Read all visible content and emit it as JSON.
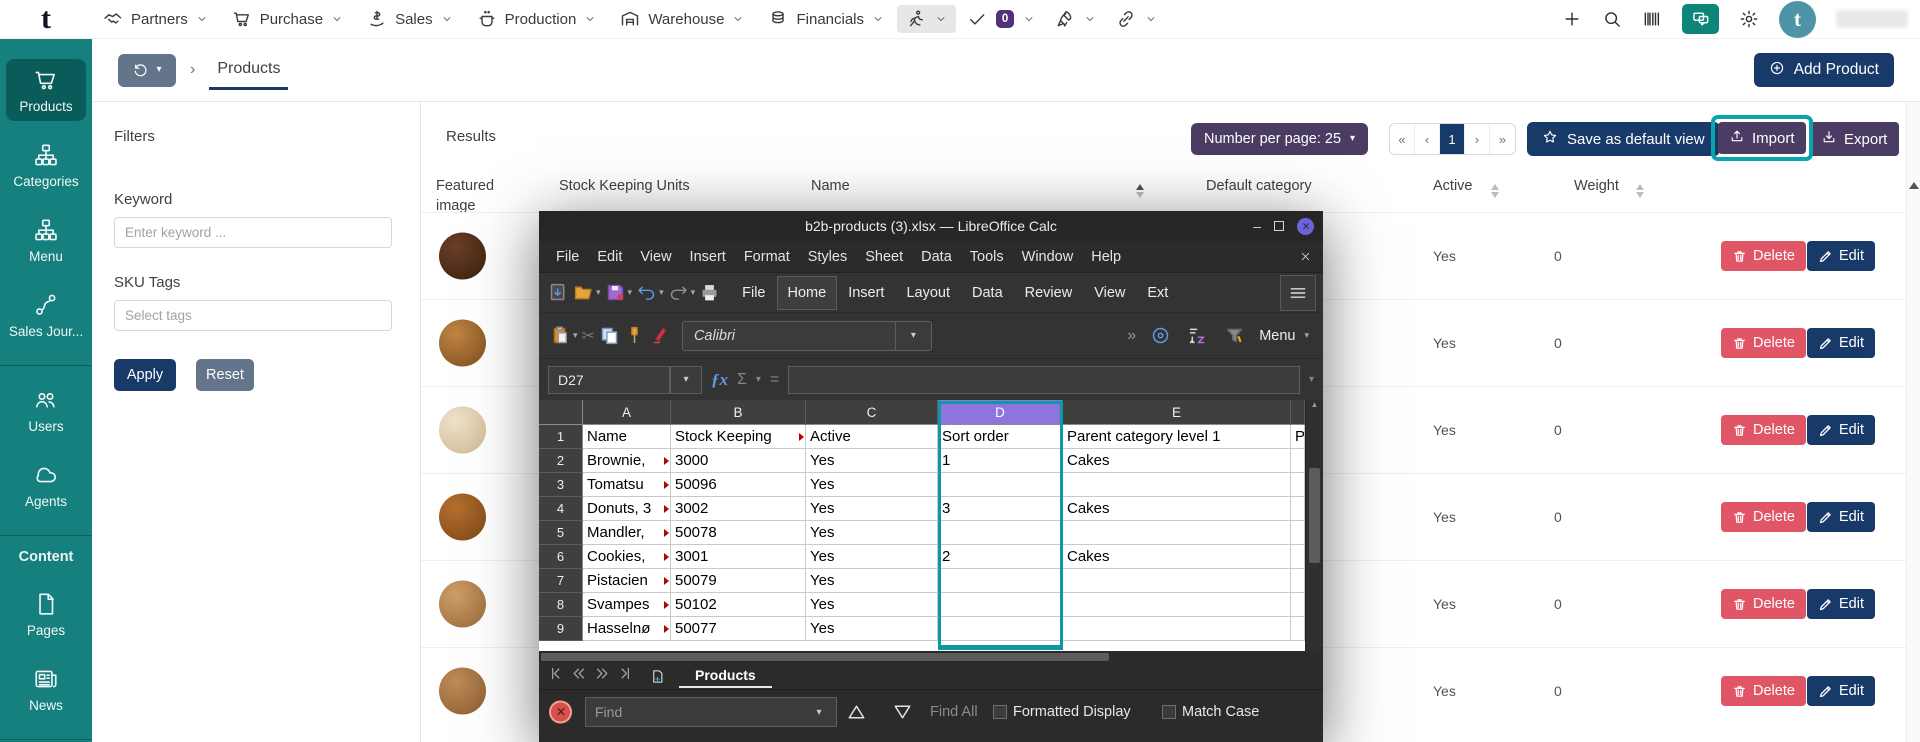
{
  "topbar": {
    "logo": "t",
    "menus": [
      {
        "label": "Partners",
        "icon": "handshake"
      },
      {
        "label": "Purchase",
        "icon": "cart"
      },
      {
        "label": "Sales",
        "icon": "sales"
      },
      {
        "label": "Production",
        "icon": "production"
      },
      {
        "label": "Warehouse",
        "icon": "warehouse"
      },
      {
        "label": "Financials",
        "icon": "financials"
      }
    ],
    "icon_menus": [
      {
        "icon": "runner",
        "active": true
      },
      {
        "icon": "check",
        "badge": "0"
      },
      {
        "icon": "rocket"
      },
      {
        "icon": "link"
      }
    ],
    "avatar_initial": "t"
  },
  "sidebar": {
    "items": [
      {
        "type": "item",
        "label": "Products",
        "icon": "cart",
        "active": true
      },
      {
        "type": "item",
        "label": "Categories",
        "icon": "sitemap"
      },
      {
        "type": "item",
        "label": "Menu",
        "icon": "sitemap"
      },
      {
        "type": "item",
        "label": "Sales Jour...",
        "icon": "route"
      },
      {
        "type": "divider"
      },
      {
        "type": "item",
        "label": "Users",
        "icon": "users"
      },
      {
        "type": "item",
        "label": "Agents",
        "icon": "cloud"
      },
      {
        "type": "divider"
      },
      {
        "type": "label",
        "label": "Content"
      },
      {
        "type": "item",
        "label": "Pages",
        "icon": "page"
      },
      {
        "type": "item",
        "label": "News",
        "icon": "news"
      },
      {
        "type": "divider"
      }
    ]
  },
  "breadcrumb": {
    "title": "Products"
  },
  "header_actions": {
    "add_product": "Add Product"
  },
  "filters": {
    "title": "Filters",
    "keyword_label": "Keyword",
    "keyword_placeholder": "Enter keyword ...",
    "sku_label": "SKU Tags",
    "sku_placeholder": "Select tags",
    "apply": "Apply",
    "reset": "Reset"
  },
  "results": {
    "title": "Results",
    "per_page": "Number per page: 25",
    "pagination": [
      {
        "label": "«"
      },
      {
        "label": "‹"
      },
      {
        "label": "1",
        "active": true
      },
      {
        "label": "›"
      },
      {
        "label": "»"
      }
    ],
    "save_view": "Save as default view",
    "import_label": "Import",
    "export_label": "Export",
    "columns": [
      "Featured image",
      "Stock Keeping Units",
      "Name",
      "Default category",
      "Active",
      "Weight"
    ],
    "rows": [
      {
        "active": "Yes",
        "weight": "0",
        "delete": "Delete",
        "edit": "Edit",
        "thumb": [
          "#6b4027",
          "#38200f"
        ]
      },
      {
        "active": "Yes",
        "weight": "0",
        "delete": "Delete",
        "edit": "Edit",
        "thumb": [
          "#c08544",
          "#7c4f1f"
        ]
      },
      {
        "active": "Yes",
        "weight": "0",
        "delete": "Delete",
        "edit": "Edit",
        "thumb": [
          "#efe3cd",
          "#cdb78f"
        ]
      },
      {
        "active": "Yes",
        "weight": "0",
        "delete": "Delete",
        "edit": "Edit",
        "thumb": [
          "#b5702f",
          "#7c4615"
        ]
      },
      {
        "active": "Yes",
        "weight": "0",
        "delete": "Delete",
        "edit": "Edit",
        "thumb": [
          "#cf9f69",
          "#96683a"
        ]
      },
      {
        "active": "Yes",
        "weight": "0",
        "delete": "Delete",
        "edit": "Edit",
        "thumb": [
          "#c08c57",
          "#8a5c30"
        ]
      }
    ]
  },
  "calc": {
    "title": "b2b-products (3).xlsx — LibreOffice Calc",
    "menubar": [
      "File",
      "Edit",
      "View",
      "Insert",
      "Format",
      "Styles",
      "Sheet",
      "Data",
      "Tools",
      "Window",
      "Help"
    ],
    "tabs": [
      {
        "label": "File"
      },
      {
        "label": "Home",
        "active": true
      },
      {
        "label": "Insert"
      },
      {
        "label": "Layout"
      },
      {
        "label": "Data"
      },
      {
        "label": "Review"
      },
      {
        "label": "View"
      },
      {
        "label": "Ext",
        "clipped": true
      }
    ],
    "font_name": "Calibri",
    "menu_button": "Menu",
    "cell_ref": "D27",
    "fx_symbol": "ƒx",
    "sigma_symbol": "Σ",
    "equals_symbol": "=",
    "columns": [
      "A",
      "B",
      "C",
      "D",
      "E",
      ""
    ],
    "selected_column": "D",
    "grid": [
      {
        "n": "1",
        "cells": [
          "Name",
          "Stock Keeping",
          "Active",
          "Sort order",
          "Parent category level 1",
          "Pa"
        ],
        "trunc": [
          false,
          true,
          false,
          false,
          false,
          false
        ]
      },
      {
        "n": "2",
        "cells": [
          "Brownie,",
          "3000",
          "Yes",
          "1",
          "Cakes",
          ""
        ],
        "trunc": [
          true,
          false,
          false,
          false,
          false,
          false
        ]
      },
      {
        "n": "3",
        "cells": [
          "Tomatsu",
          "50096",
          "Yes",
          "",
          "",
          ""
        ],
        "trunc": [
          true,
          false,
          false,
          false,
          false,
          false
        ]
      },
      {
        "n": "4",
        "cells": [
          "Donuts, 3",
          "3002",
          "Yes",
          "3",
          "Cakes",
          ""
        ],
        "trunc": [
          true,
          false,
          false,
          false,
          false,
          false
        ]
      },
      {
        "n": "5",
        "cells": [
          "Mandler,",
          "50078",
          "Yes",
          "",
          "",
          ""
        ],
        "trunc": [
          true,
          false,
          false,
          false,
          false,
          false
        ]
      },
      {
        "n": "6",
        "cells": [
          "Cookies,",
          "3001",
          "Yes",
          "2",
          "Cakes",
          ""
        ],
        "trunc": [
          true,
          false,
          false,
          false,
          false,
          false
        ]
      },
      {
        "n": "7",
        "cells": [
          "Pistacien",
          "50079",
          "Yes",
          "",
          "",
          ""
        ],
        "trunc": [
          true,
          false,
          false,
          false,
          false,
          false
        ]
      },
      {
        "n": "8",
        "cells": [
          "Svampes",
          "50102",
          "Yes",
          "",
          "",
          ""
        ],
        "trunc": [
          true,
          false,
          false,
          false,
          false,
          false
        ]
      },
      {
        "n": "9",
        "cells": [
          "Hasselnø",
          "50077",
          "Yes",
          "",
          "",
          ""
        ],
        "trunc": [
          true,
          false,
          false,
          false,
          false,
          false
        ]
      }
    ],
    "sheet_tab": "Products",
    "find": {
      "placeholder": "Find",
      "find_all": "Find All",
      "formatted": "Formatted Display",
      "match_case": "Match Case"
    }
  },
  "colors": {
    "annotation_teal": "#0ba3ad",
    "navy": "#173a68",
    "purple_button": "#4b3c64",
    "sidebar_teal": "#16807e",
    "delete_red": "#e05666",
    "selected_column_header": "#8d75dd"
  }
}
